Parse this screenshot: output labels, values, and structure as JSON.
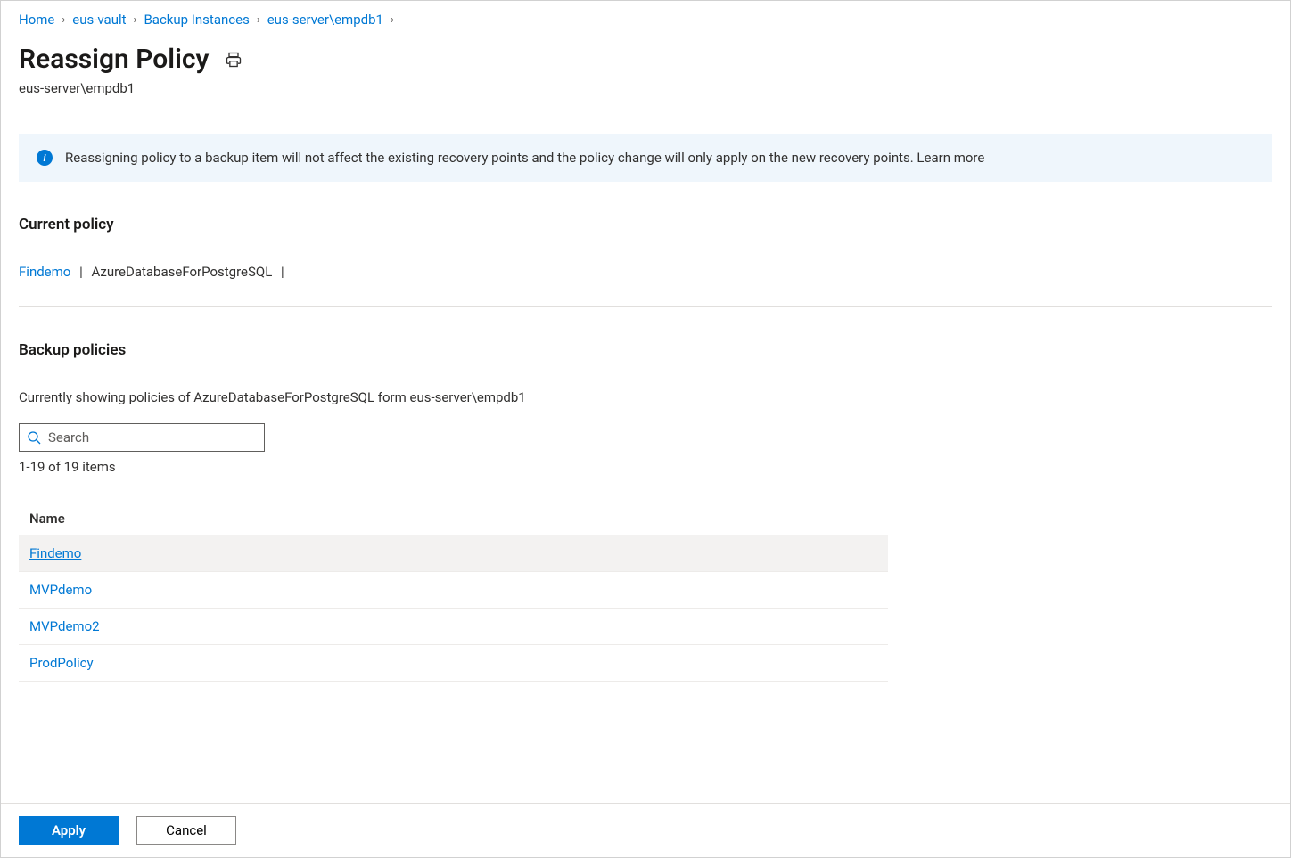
{
  "breadcrumb": [
    {
      "label": "Home"
    },
    {
      "label": "eus-vault"
    },
    {
      "label": "Backup Instances"
    },
    {
      "label": "eus-server\\empdb1"
    }
  ],
  "page": {
    "title": "Reassign Policy",
    "subtitle": "eus-server\\empdb1"
  },
  "info": {
    "text": "Reassigning policy to a backup item will not affect the existing recovery points and the policy change will only apply on the new recovery points. Learn more"
  },
  "current_policy": {
    "heading": "Current policy",
    "name": "Findemo",
    "type": "AzureDatabaseForPostgreSQL"
  },
  "backup_policies": {
    "heading": "Backup policies",
    "description": "Currently showing policies of AzureDatabaseForPostgreSQL form eus-server\\empdb1",
    "search_placeholder": "Search",
    "count_text": "1-19 of 19 items",
    "column_header": "Name",
    "rows": [
      {
        "name": "Findemo",
        "selected": true
      },
      {
        "name": "MVPdemo",
        "selected": false
      },
      {
        "name": "MVPdemo2",
        "selected": false
      },
      {
        "name": "ProdPolicy",
        "selected": false
      }
    ]
  },
  "footer": {
    "apply": "Apply",
    "cancel": "Cancel"
  }
}
